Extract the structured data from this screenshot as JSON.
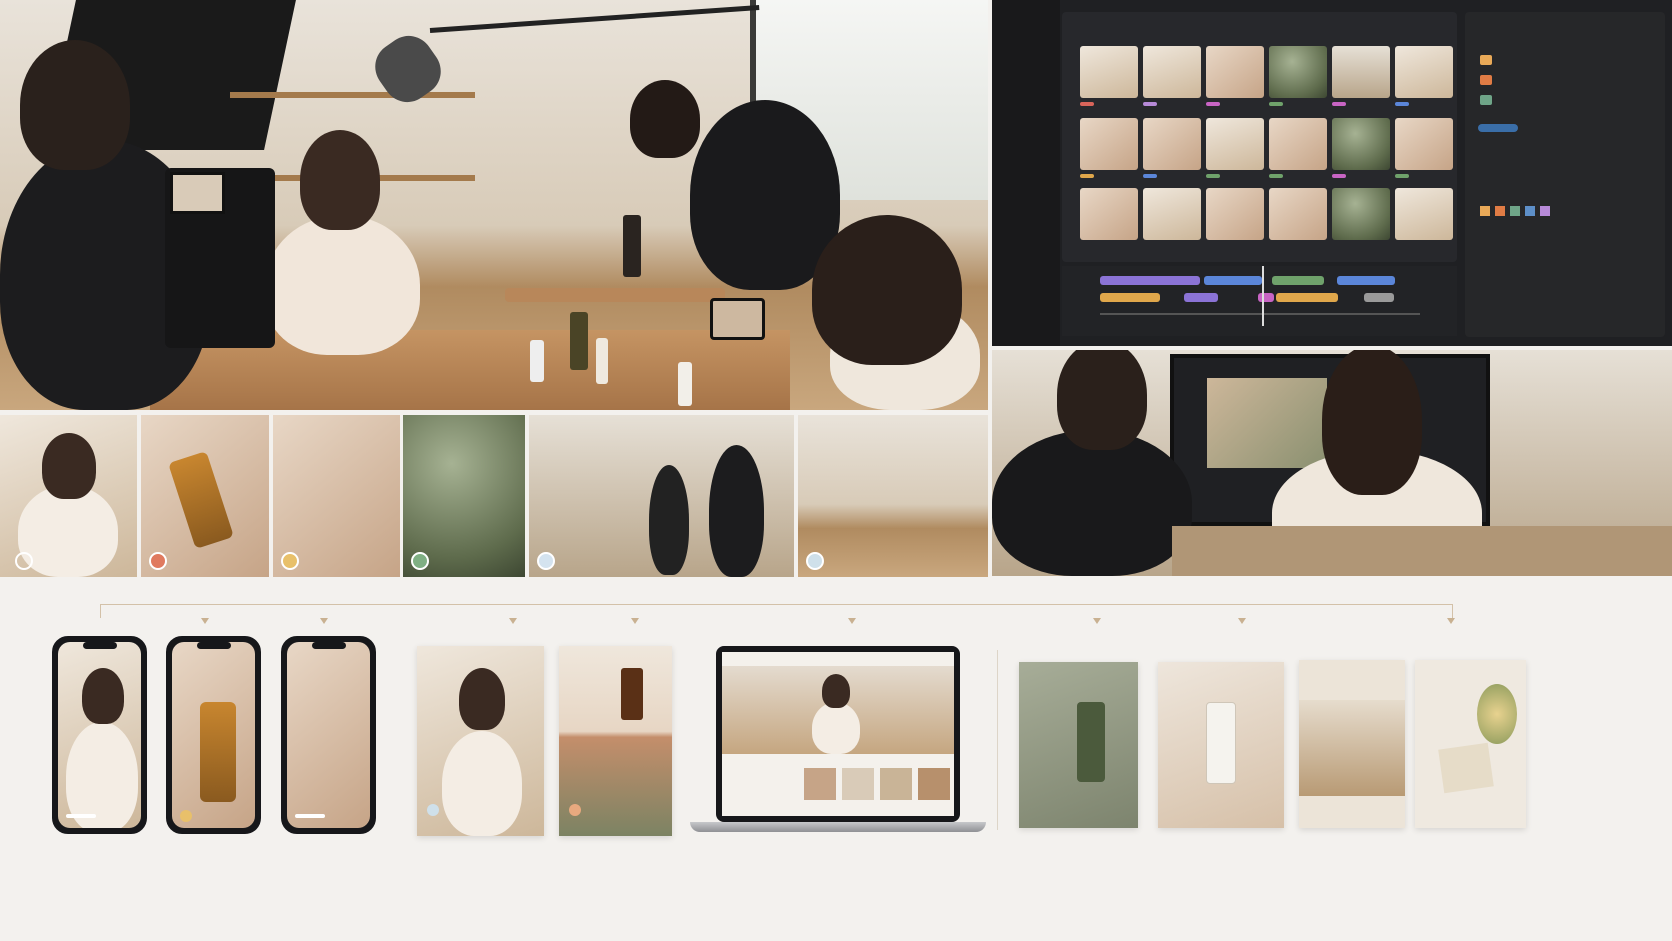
{
  "sections": {
    "shoot_scene": "studio shoot",
    "clips": [
      "interview",
      "serum",
      "hands",
      "leaf",
      "crew",
      "room"
    ],
    "editor": {
      "swatches": [
        "#e8a958",
        "#e07c45",
        "#6fa588",
        "#5d8fc8",
        "#b78ad8"
      ],
      "clip_dot_colors": [
        "#ffffff",
        "#e07a5f",
        "#e8c06a",
        "#7faf83",
        "#d4e3ef",
        "#cfe0ea"
      ],
      "timeline_colors": [
        "#8b73d6",
        "#e0a74b",
        "#6fa26b",
        "#5b86d9",
        "#c864c4",
        "#9a9a9a"
      ]
    },
    "deliverables": [
      "phone-1",
      "phone-2",
      "phone-3",
      "card-1",
      "card-2",
      "laptop",
      "print-1",
      "print-2",
      "print-3",
      "print-4"
    ]
  }
}
